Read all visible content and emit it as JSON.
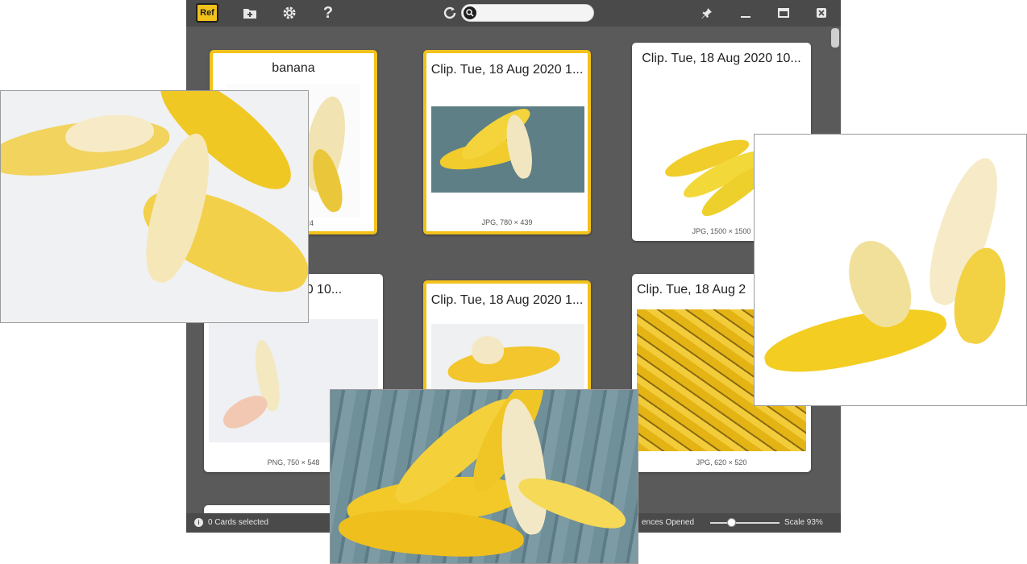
{
  "app": {
    "logo_text": "Ref",
    "search": {
      "value": "",
      "placeholder": ""
    },
    "toolbar_icons": [
      "add-folder-icon",
      "gear-icon",
      "help-icon",
      "refresh-icon",
      "search-icon",
      "pin-icon",
      "minimize-icon",
      "maximize-icon",
      "close-icon"
    ]
  },
  "cards": [
    {
      "title": "banana",
      "meta": "1024",
      "selected": true
    },
    {
      "title": "Clip. Tue, 18 Aug 2020 1...",
      "meta": "JPG, 780 × 439",
      "selected": true
    },
    {
      "title": "Clip. Tue, 18 Aug 2020 10...",
      "meta": "JPG, 1500 × 1500",
      "selected": false
    },
    {
      "title": "2020 10...",
      "meta": "PNG, 750 × 548",
      "selected": false
    },
    {
      "title": "Clip. Tue, 18 Aug 2020 1...",
      "meta": "",
      "selected": true
    },
    {
      "title": "Clip. Tue, 18 Aug 2",
      "meta": "JPG, 620 × 520",
      "selected": false
    }
  ],
  "status": {
    "selected": "0 Cards selected",
    "references": "ences Opened",
    "scale": "Scale 93%",
    "scale_value": 0.28
  },
  "colors": {
    "accent": "#f2c21b",
    "window_bg": "#5a5a5a",
    "toolbar_bg": "#4a4a4a"
  }
}
